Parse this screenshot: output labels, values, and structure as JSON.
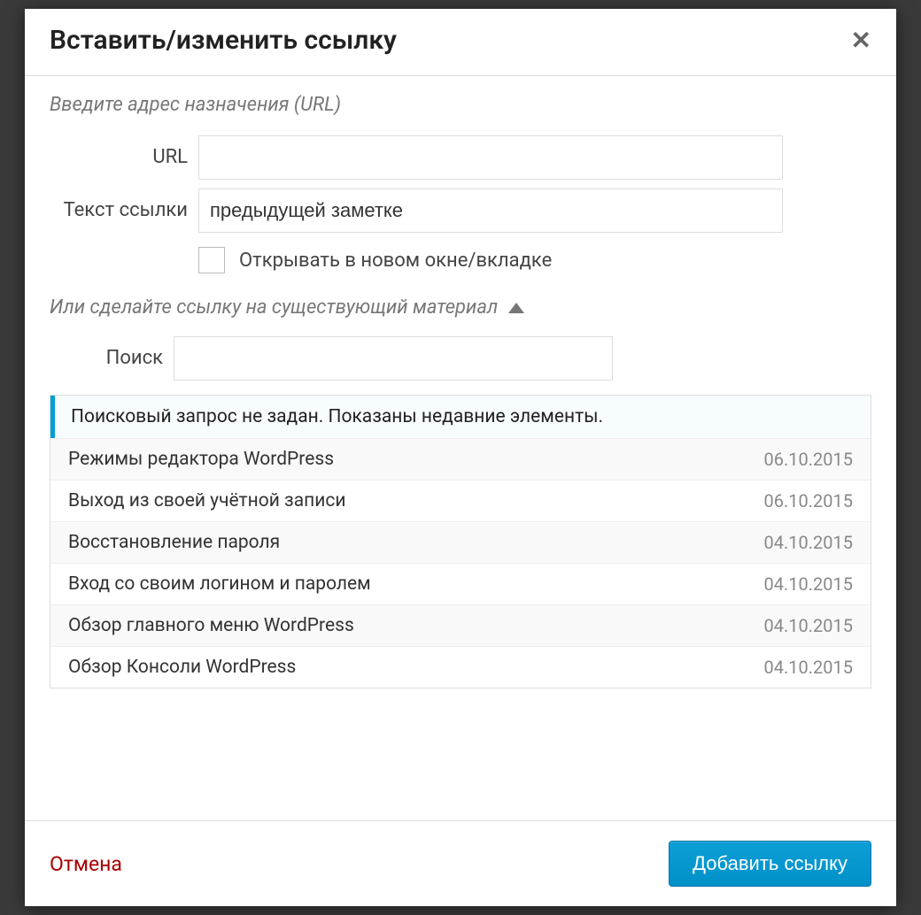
{
  "modal": {
    "title": "Вставить/изменить ссылку",
    "close_label": "✕",
    "destination_section": "Введите адрес назначения (URL)",
    "url_label": "URL",
    "url_value": "",
    "text_label": "Текст ссылки",
    "text_value": "предыдущей заметке",
    "newtab_label": "Открывать в новом окне/вкладке",
    "newtab_checked": false,
    "existing_section": "Или сделайте ссылку на существующий материал",
    "search_label": "Поиск",
    "search_value": "",
    "results_notice": "Поисковый запрос не задан. Показаны недавние элементы.",
    "results": [
      {
        "title": "Режимы редактора WordPress",
        "date": "06.10.2015"
      },
      {
        "title": "Выход из своей учётной записи",
        "date": "06.10.2015"
      },
      {
        "title": "Восстановление пароля",
        "date": "04.10.2015"
      },
      {
        "title": "Вход со своим логином и паролем",
        "date": "04.10.2015"
      },
      {
        "title": "Обзор главного меню WordPress",
        "date": "04.10.2015"
      },
      {
        "title": "Обзор Консоли WordPress",
        "date": "04.10.2015"
      }
    ],
    "cancel_label": "Отмена",
    "submit_label": "Добавить ссылку"
  }
}
